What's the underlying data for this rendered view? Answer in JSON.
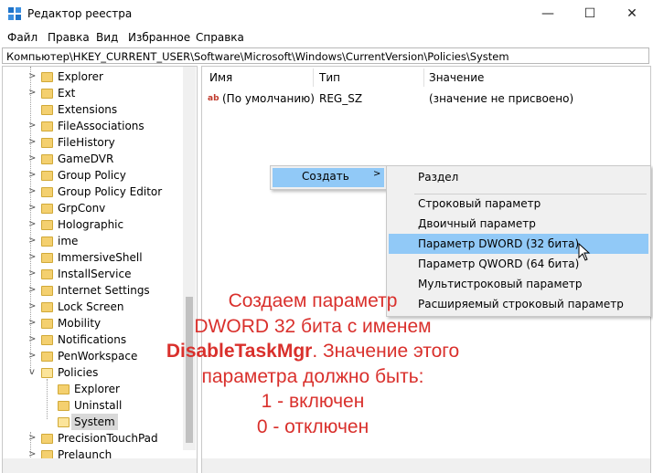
{
  "window": {
    "title": "Редактор реестра",
    "minimize_glyph": "—",
    "maximize_glyph": "☐",
    "close_glyph": "✕"
  },
  "menu": [
    "Файл",
    "Правка",
    "Вид",
    "Избранное",
    "Справка"
  ],
  "address": "Компьютер\\HKEY_CURRENT_USER\\Software\\Microsoft\\Windows\\CurrentVersion\\Policies\\System",
  "tree": [
    {
      "label": "Explorer",
      "expander": ">"
    },
    {
      "label": "Ext",
      "expander": ">"
    },
    {
      "label": "Extensions",
      "expander": ""
    },
    {
      "label": "FileAssociations",
      "expander": ">"
    },
    {
      "label": "FileHistory",
      "expander": ">"
    },
    {
      "label": "GameDVR",
      "expander": ">"
    },
    {
      "label": "Group Policy",
      "expander": ">"
    },
    {
      "label": "Group Policy Editor",
      "expander": ">"
    },
    {
      "label": "GrpConv",
      "expander": ">"
    },
    {
      "label": "Holographic",
      "expander": ">"
    },
    {
      "label": "ime",
      "expander": ">"
    },
    {
      "label": "ImmersiveShell",
      "expander": ">"
    },
    {
      "label": "InstallService",
      "expander": ">"
    },
    {
      "label": "Internet Settings",
      "expander": ">"
    },
    {
      "label": "Lock Screen",
      "expander": ">"
    },
    {
      "label": "Mobility",
      "expander": ">"
    },
    {
      "label": "Notifications",
      "expander": ">"
    },
    {
      "label": "PenWorkspace",
      "expander": ">"
    },
    {
      "label": "Policies",
      "expander": "v"
    },
    {
      "label": "Explorer",
      "expander": ""
    },
    {
      "label": "Uninstall",
      "expander": ""
    },
    {
      "label": "System",
      "expander": ""
    },
    {
      "label": "PrecisionTouchPad",
      "expander": ">"
    },
    {
      "label": "Prelaunch",
      "expander": ">"
    }
  ],
  "columns": {
    "name": "Имя",
    "type": "Тип",
    "value": "Значение"
  },
  "rows": [
    {
      "icon": "string-value-icon",
      "icon_text": "ab",
      "name": "(По умолчанию)",
      "type": "REG_SZ",
      "value": "(значение не присвоено)"
    }
  ],
  "context_menu": {
    "create_label": "Создать",
    "create_arrow": ">",
    "submenu": [
      "Раздел",
      "Строковый параметр",
      "Двоичный параметр",
      "Параметр DWORD (32 бита)",
      "Параметр QWORD (64 бита)",
      "Мультистроковый параметр",
      "Расширяемый строковый параметр"
    ]
  },
  "annotation": {
    "line1": "Создаем параметр",
    "line2": "DWORD 32 бита с именем",
    "line3_bold": "DisableTaskMgr",
    "line3_rest": ". Значение этого",
    "line4": "параметра должно быть:",
    "line5": "1 - включен",
    "line6": "0 - отключен"
  },
  "colors": {
    "highlight": "#91c9f7",
    "annotation": "#d9302c",
    "folder": "#f4d06f"
  }
}
